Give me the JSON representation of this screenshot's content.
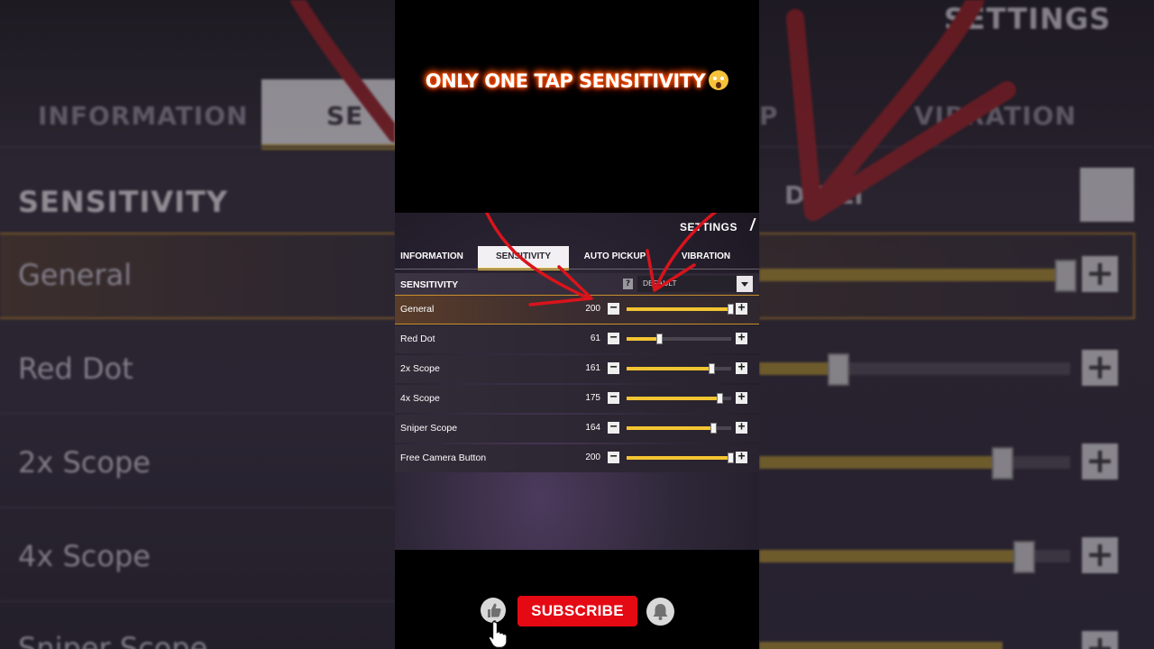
{
  "video": {
    "headline": "ONLY ONE TAP SENSITIVITY",
    "headline_emoji": "face-screaming-emoji"
  },
  "game": {
    "title": "SETTINGS",
    "tabs": [
      {
        "label": "INFORMATION",
        "active": false
      },
      {
        "label": "SENSITIVITY",
        "active": true
      },
      {
        "label": "AUTO PICKUP",
        "active": false
      },
      {
        "label": "VIBRATION",
        "active": false
      }
    ],
    "section_title": "SENSITIVITY",
    "help_icon": "?",
    "preset_value": "DEFAULT",
    "rows": [
      {
        "label": "General",
        "value": "200",
        "level": 1.0,
        "selected": true
      },
      {
        "label": "Red Dot",
        "value": "61",
        "level": 0.305,
        "selected": false
      },
      {
        "label": "2x Scope",
        "value": "161",
        "level": 0.805,
        "selected": false
      },
      {
        "label": "4x Scope",
        "value": "175",
        "level": 0.875,
        "selected": false
      },
      {
        "label": "Sniper Scope",
        "value": "164",
        "level": 0.82,
        "selected": false
      },
      {
        "label": "Free Camera Button",
        "value": "200",
        "level": 1.0,
        "selected": false
      }
    ],
    "minus_symbol": "−",
    "plus_symbol": "+"
  },
  "background": {
    "tabs_left": [
      "INFORMATION",
      "SE"
    ],
    "tabs_right": [
      "P",
      "VIBRATION"
    ],
    "title_right": "SETTINGS",
    "section_left": "SENSITIVITY",
    "preset_right": "D   ULT",
    "rows_left": [
      "General",
      "Red Dot",
      "2x Scope",
      "4x Scope",
      "Sniper Scope"
    ]
  },
  "bottom_bar": {
    "subscribe_label": "SUBSCRIBE",
    "like_icon": "thumbs-up-icon",
    "bell_icon": "bell-icon"
  },
  "colors": {
    "accent_yellow": "#f3c532",
    "subscribe_red": "#e50914",
    "arrow_red": "#d8141c"
  }
}
